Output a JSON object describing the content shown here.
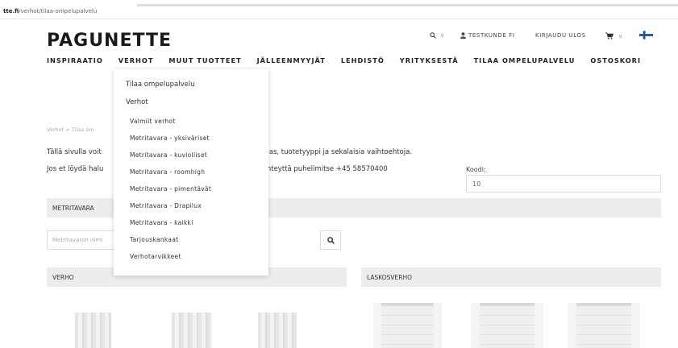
{
  "browser": {
    "url_domain": "tte.fi",
    "url_path": "/verhot/tilaa-ompelupalvelu"
  },
  "header": {
    "logo": "PAGUNETTE",
    "utility": {
      "search_icon": "magnifier-icon",
      "search_caret": "∨",
      "user_icon": "person-icon",
      "account": "TESTKUNDE FI",
      "logout": "KIRJAUDU ULOS",
      "cart_icon": "shopping-cart-icon",
      "cart_caret": "∨",
      "flag": "finnish-flag"
    }
  },
  "nav": [
    "INSPIRAATIO",
    "VERHOT",
    "MUUT TUOTTEET",
    "JÄLLEENMYYJÄT",
    "LEHDISTÖ",
    "YRITYKSESTÄ",
    "TILAA OMPELUPALVELU",
    "OSTOSKORI"
  ],
  "dropdown": {
    "top_items": [
      "Tilaa ompelupalvelu",
      "Verhot"
    ],
    "sub_items": [
      "Valmiit verhot",
      "Metritavara - yksiväriset",
      "Metritavara - kuviolliset",
      "Metritavara - roomhigh",
      "Metritavara - pimentävät",
      "Metritavara - Drapilux",
      "Metritavara - kaikki",
      "Tarjouskankaat",
      "Verhotarvikkeet"
    ]
  },
  "breadcrumb": "Verhot > Tilaa om",
  "content": {
    "line1_left": "Tällä sivulla voit",
    "line1_right": "kangas, tuotetyyppi ja sekalaisia vaihtoehtoja.",
    "line2_left": "Jos et löydä halu",
    "line2_right": "sti yhteyttä puhelimitse +45 58570400"
  },
  "koodi": {
    "label": "Koodi:",
    "value": "10"
  },
  "sections": {
    "metritavara": "METRITAVARA",
    "search_placeholder": "Metritavaron nimi",
    "verho": "VERHO",
    "laskosverho": "LASKOSVERHO"
  },
  "colors": {
    "flag_blue": "#1e4fa3",
    "bar_bg": "#ededed",
    "text": "#333333"
  }
}
